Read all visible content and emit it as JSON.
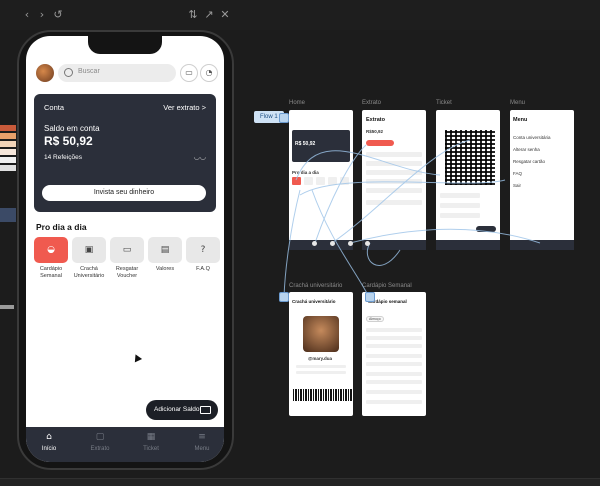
{
  "toolbar": {
    "back_icon": "‹",
    "forward_icon": "›",
    "refresh_icon": "↺",
    "adjust_icon": "⇅",
    "open_external_icon": "↗",
    "close_icon": "✕"
  },
  "app": {
    "search_placeholder": "Buscar",
    "chat_icon": "▭",
    "bell_icon": "◔",
    "card": {
      "account_label": "Conta",
      "statement_link": "Ver extrato >",
      "balance_label": "Saldo em conta",
      "balance_value": "R$ 50,92",
      "meals": "14 Refeições",
      "eye_icon": "◡◡",
      "invest_button": "Invista seu dinheiro"
    },
    "section_title": "Pro dia a dia",
    "quick_actions": [
      {
        "label": "Cardápio Semanal",
        "icon": "◒"
      },
      {
        "label": "Crachá Universitário",
        "icon": "▣"
      },
      {
        "label": "Resgatar Voucher",
        "icon": "▭"
      },
      {
        "label": "Valores",
        "icon": "▤"
      },
      {
        "label": "F.A.Q",
        "icon": "?"
      }
    ],
    "add_balance_button": "Adicionar Saldo",
    "tabs": [
      {
        "label": "Início",
        "icon": "⌂"
      },
      {
        "label": "Extrato",
        "icon": "▢"
      },
      {
        "label": "Ticket",
        "icon": "▦"
      },
      {
        "label": "Menu",
        "icon": "≡"
      }
    ]
  },
  "canvas": {
    "flow_label": "Flow 1",
    "frames": {
      "home": {
        "title": "Home",
        "balance": "R$ 50,92",
        "section": "Pro dia a dia"
      },
      "extrato": {
        "title": "Extrato",
        "heading": "Extrato",
        "amount": "R$50,92"
      },
      "ticket": {
        "title": "Ticket"
      },
      "menu": {
        "title": "Menu",
        "heading": "Menu",
        "items": [
          "Conta universitária",
          "Alterar senha",
          "Resgatar cartão",
          "FAQ",
          "Sair"
        ]
      },
      "cracha": {
        "title": "Crachá universitário",
        "heading": "Crachá universitário",
        "handle": "@mary.dua"
      },
      "cardapio": {
        "title": "Cardápio Semanal",
        "heading": "Cardápio semanal",
        "filter": "Almoço"
      }
    }
  },
  "colors": {
    "card_bg": "#2b2f3a",
    "accent_red": "#f05a4f",
    "flow_blue": "#b9d4ee"
  }
}
